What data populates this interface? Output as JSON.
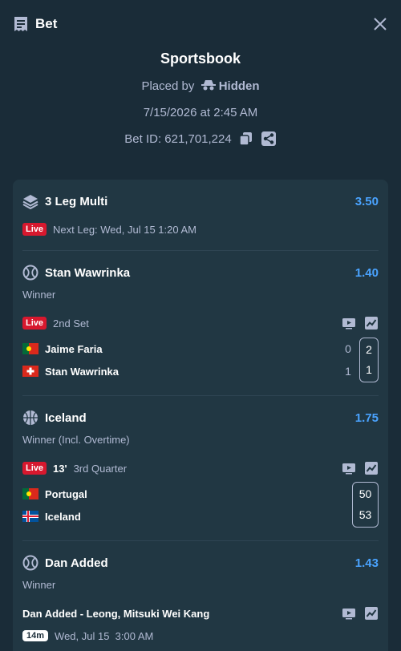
{
  "header": {
    "title": "Bet"
  },
  "summary": {
    "title": "Sportsbook",
    "placed_by_label": "Placed by",
    "placed_by_user": "Hidden",
    "date": "7/15/2026 at 2:45 AM",
    "bet_id": "Bet ID: 621,701,224"
  },
  "multi": {
    "label": "3 Leg Multi",
    "odds": "3.50",
    "live_badge": "Live",
    "next_leg": "Next Leg: Wed, Jul 15 1:20 AM"
  },
  "legs": [
    {
      "selection": "Stan Wawrinka",
      "odds": "1.40",
      "market": "Winner",
      "live_badge": "Live",
      "status": "2nd Set",
      "teams": [
        {
          "name": "Jaime Faria",
          "flag": "portugal",
          "set_score": "0",
          "game_score": "2"
        },
        {
          "name": "Stan Wawrinka",
          "flag": "switzerland",
          "set_score": "1",
          "game_score": "1"
        }
      ]
    },
    {
      "selection": "Iceland",
      "odds": "1.75",
      "market": "Winner (Incl. Overtime)",
      "live_badge": "Live",
      "clock": "13'",
      "status": "3rd Quarter",
      "teams": [
        {
          "name": "Portugal",
          "flag": "portugal",
          "score": "50"
        },
        {
          "name": "Iceland",
          "flag": "iceland",
          "score": "53"
        }
      ]
    },
    {
      "selection": "Dan Added",
      "odds": "1.43",
      "market": "Winner",
      "event": "Dan Added - Leong, Mitsuki Wei Kang",
      "countdown": "14m",
      "start": "Wed, Jul 15  3:00 AM"
    }
  ],
  "colors": {
    "accent_blue": "#4aa3ff",
    "live_red": "#d7182e",
    "bg": "#1a2c38",
    "card": "#213743"
  }
}
